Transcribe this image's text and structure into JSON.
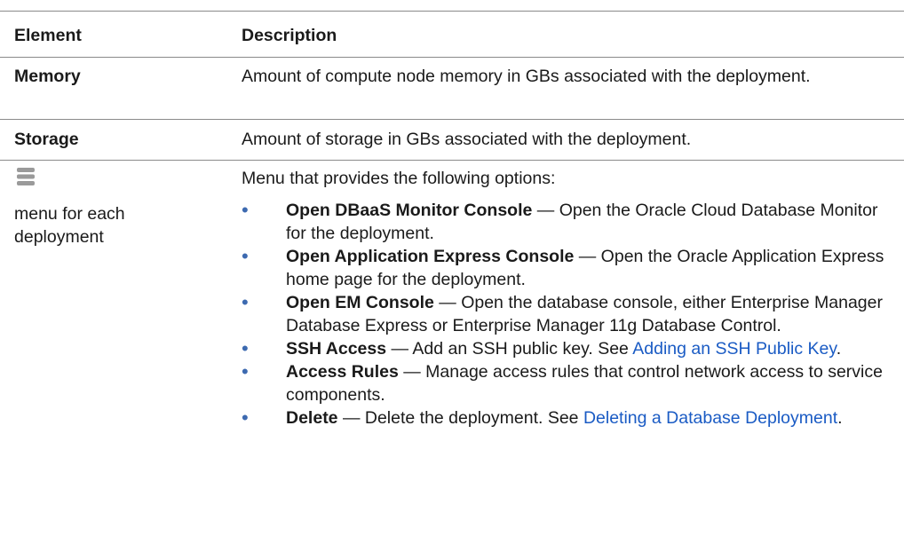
{
  "header": {
    "col1": "Element",
    "col2": "Description"
  },
  "rows": [
    {
      "element": "Memory",
      "description": "Amount of compute node memory in GBs associated with the deployment."
    },
    {
      "element": "Storage",
      "description": "Amount of storage in GBs associated with the deployment."
    }
  ],
  "menu_row": {
    "icon": "hamburger-menu-icon",
    "element_label": "menu for each deployment",
    "intro": "Menu that provides the following options:",
    "options": [
      {
        "title": "Open DBaaS Monitor Console",
        "text": " — Open the Oracle Cloud Database Monitor for the deployment."
      },
      {
        "title": "Open Application Express Console",
        "text": " — Open the Oracle Application Express home page for the deployment."
      },
      {
        "title": "Open EM Console",
        "text": " — Open the database console, either Enterprise Manager Database Express or Enterprise Manager 11g Database Control."
      },
      {
        "title": "SSH Access",
        "text": " — Add an SSH public key. See ",
        "link": "Adding an SSH Public Key",
        "after": "."
      },
      {
        "title": "Access Rules",
        "text": " — Manage access rules that control network access to service components."
      },
      {
        "title": "Delete",
        "text": " — Delete the deployment. See ",
        "link": "Deleting a Database Deployment",
        "after": "."
      }
    ]
  },
  "colors": {
    "link": "#1a5bc4",
    "bullet": "#3d6ab0",
    "rule": "#8a8a8a"
  }
}
